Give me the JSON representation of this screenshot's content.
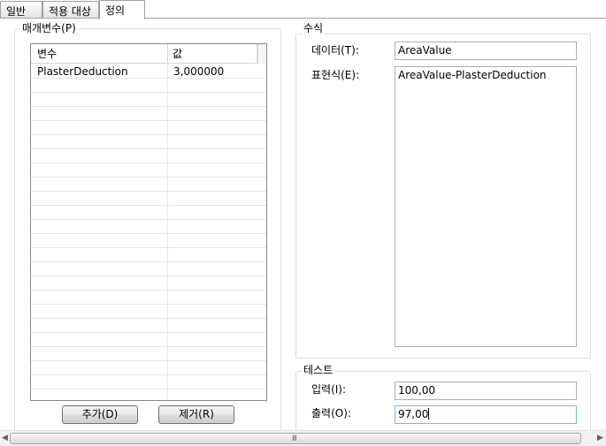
{
  "tabs": [
    {
      "label": "일반",
      "active": false
    },
    {
      "label": "적용 대상",
      "active": false
    },
    {
      "label": "정의",
      "active": true
    }
  ],
  "parameters": {
    "group_title": "매개변수(P)",
    "columns": [
      "변수",
      "값"
    ],
    "rows": [
      {
        "name": "PlasterDeduction",
        "value": "3,000000"
      }
    ],
    "add_button": "추가(D)",
    "remove_button": "제거(R)"
  },
  "formula": {
    "group_title": "수식",
    "data_label": "데이터(T):",
    "data_value": "AreaValue",
    "expression_label": "표현식(E):",
    "expression_value": "AreaValue-PlasterDeduction"
  },
  "test": {
    "group_title": "테스트",
    "input_label": "입력(I):",
    "input_value": "100,00",
    "output_label": "출력(O):",
    "output_value": "97,00"
  },
  "scrollbar": {
    "left_arrow": "◀",
    "right_arrow": "▶",
    "grip": "III"
  },
  "colors": {
    "group_border": "#d5dfe5",
    "field_border": "#abadb3",
    "focus_border": "#7eb4ea"
  }
}
